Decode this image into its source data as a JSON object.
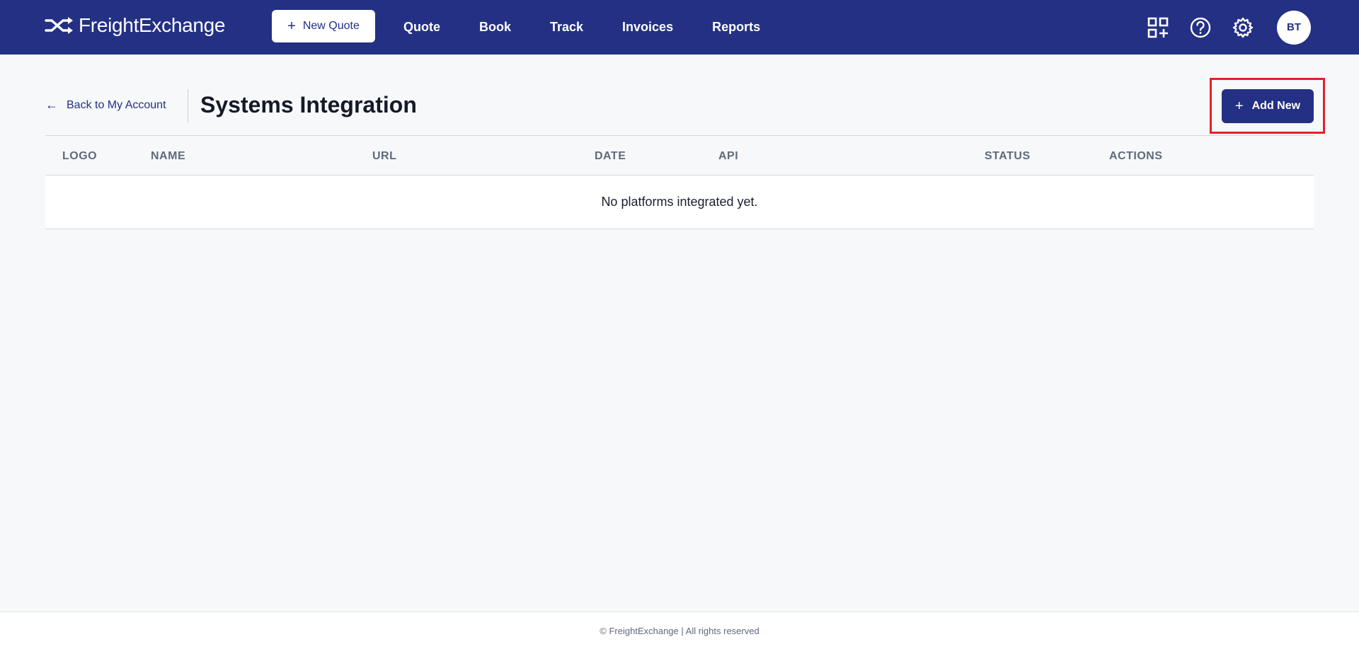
{
  "brand": {
    "name": "FreightExchange"
  },
  "topbar": {
    "new_quote_label": "New Quote",
    "nav": [
      "Quote",
      "Book",
      "Track",
      "Invoices",
      "Reports"
    ],
    "avatar_initials": "BT"
  },
  "page": {
    "back_label": "Back to My Account",
    "title": "Systems Integration",
    "add_new_label": "Add New"
  },
  "table": {
    "columns": [
      "LOGO",
      "NAME",
      "URL",
      "DATE",
      "API",
      "STATUS",
      "ACTIONS"
    ],
    "empty_message": "No platforms integrated yet."
  },
  "footer": {
    "text": "© FreightExchange | All rights reserved"
  },
  "colors": {
    "primary": "#233084",
    "highlight": "#e3202b",
    "background": "#f7f8fa"
  }
}
